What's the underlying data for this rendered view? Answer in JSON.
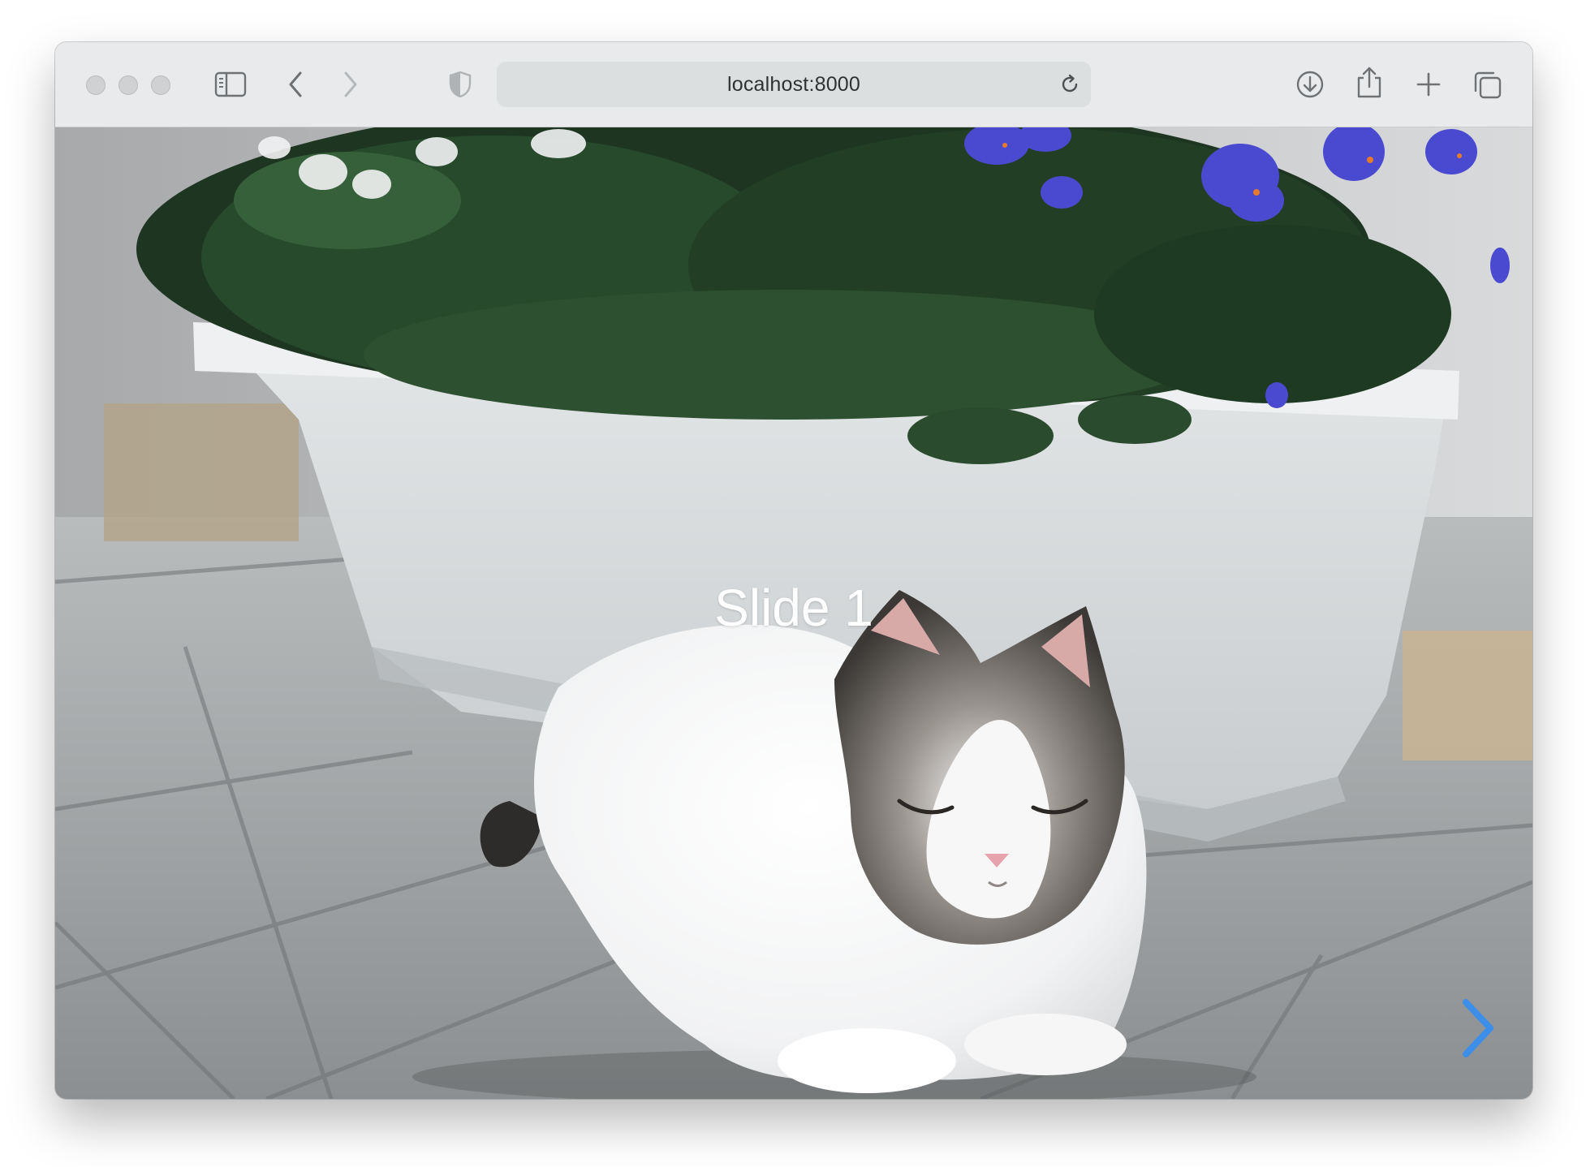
{
  "browser": {
    "url": "localhost:8000",
    "icons": {
      "sidebar": "sidebar-icon",
      "back": "chevron-left-icon",
      "forward": "chevron-right-icon",
      "privacy": "shield-icon",
      "reload": "reload-icon",
      "download": "download-icon",
      "share": "share-icon",
      "new_tab": "plus-icon",
      "tabs": "tabs-overview-icon"
    }
  },
  "slider": {
    "current_slide_label": "Slide 1",
    "next_icon": "chevron-right-icon",
    "accent_color": "#3d8ee8"
  }
}
